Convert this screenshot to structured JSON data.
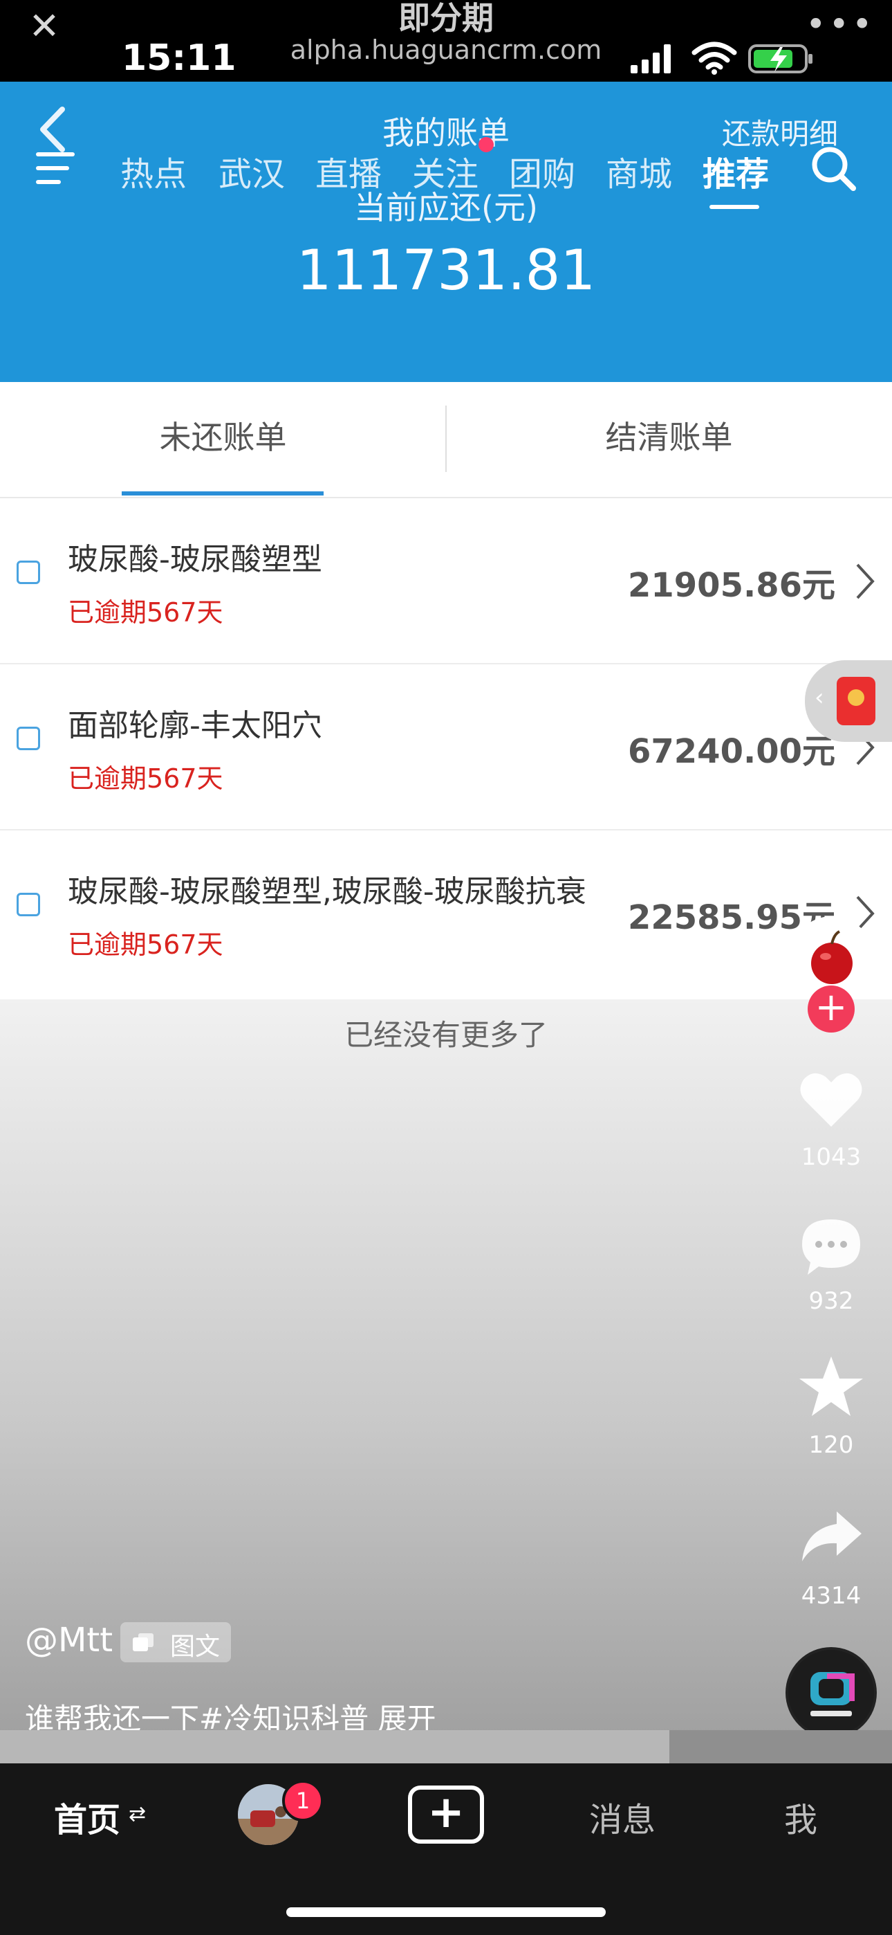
{
  "status_bar": {
    "close_icon": "close-icon",
    "site_title": "即分期",
    "time": "15:11",
    "url": "alpha.huaguancrm.com",
    "more_icon": "more-dots-icon"
  },
  "header": {
    "title": "我的账单",
    "repayment_link": "还款明细",
    "nav_tabs": [
      "热点",
      "武汉",
      "直播",
      "关注",
      "团购",
      "商城",
      "推荐"
    ],
    "active_tab": "推荐",
    "due_label": "当前应还(元)",
    "due_amount": "111731.81"
  },
  "bill_tabs": {
    "unpaid": "未还账单",
    "settled": "结清账单"
  },
  "bills": [
    {
      "name": "玻尿酸-玻尿酸塑型",
      "overdue": "已逾期567天",
      "amount": "21905.86元"
    },
    {
      "name": "面部轮廓-丰太阳穴",
      "overdue": "已逾期567天",
      "amount": "67240.00元"
    },
    {
      "name": "玻尿酸-玻尿酸塑型,玻尿酸-玻尿酸抗衰",
      "overdue": "已逾期567天",
      "amount": "22585.95元"
    }
  ],
  "no_more_text": "已经没有更多了",
  "side_actions": {
    "like_count": "1043",
    "comment_count": "932",
    "favorite_count": "120",
    "share_count": "4314"
  },
  "post": {
    "author": "@Mtt",
    "type_badge": "图文",
    "caption": "谁帮我还一下#冷知识科普  展开",
    "progress": 0.75
  },
  "bottom_nav": {
    "home": "首页",
    "friend_badge": "1",
    "create_symbol": "+",
    "messages": "消息",
    "me": "我"
  },
  "colors": {
    "header_blue": "#1f95d9",
    "overdue_red": "#d9231f",
    "accent_underline": "#2a8fd8",
    "follow_red": "#f23b5a"
  }
}
